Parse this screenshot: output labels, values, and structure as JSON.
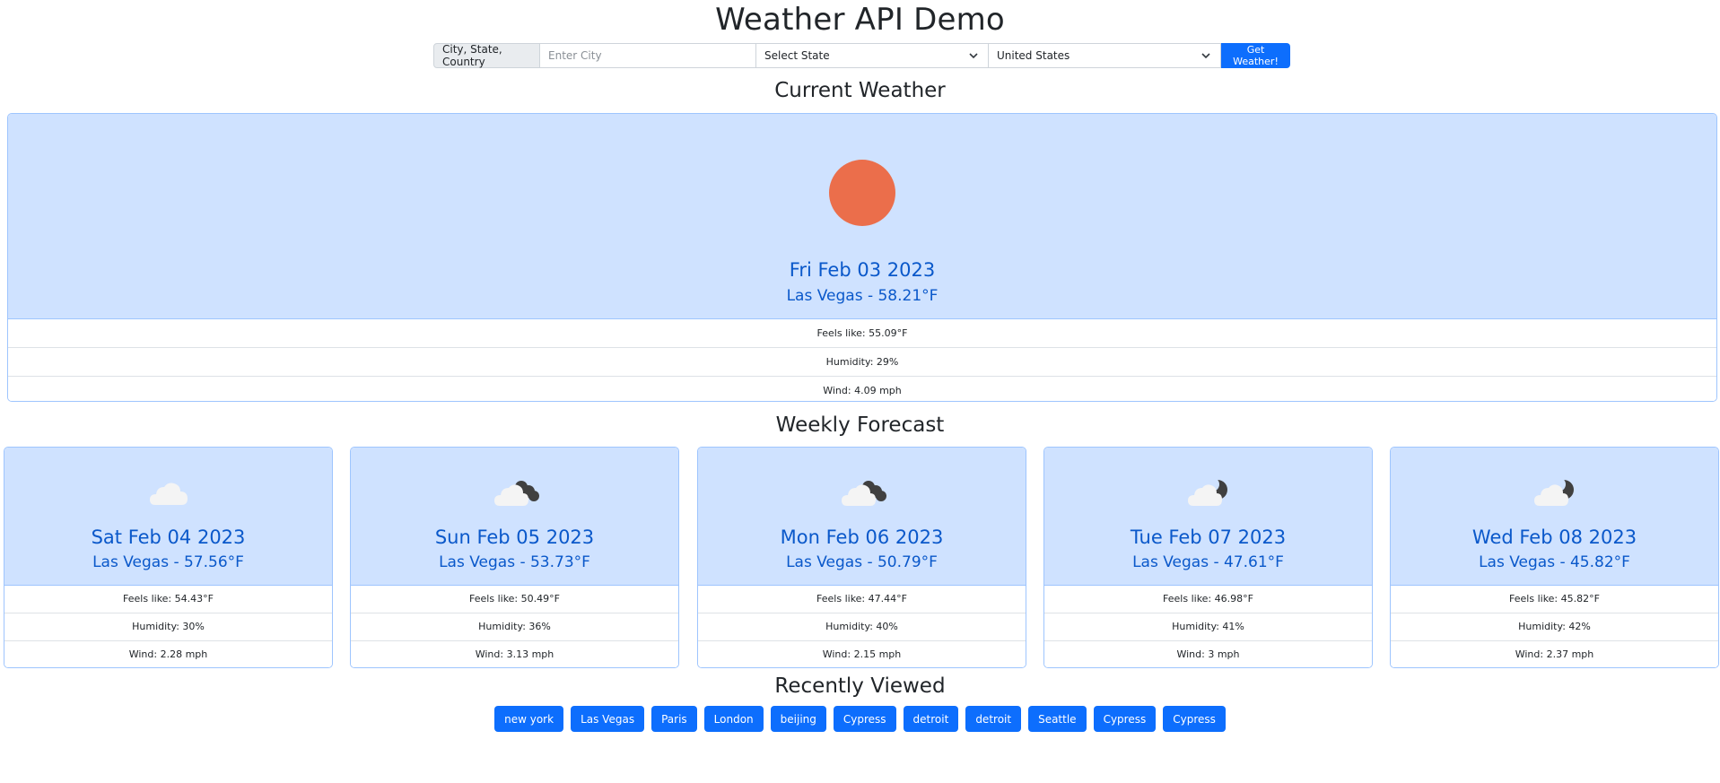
{
  "app": {
    "title": "Weather API Demo"
  },
  "search": {
    "addon_label": "City, State, Country",
    "city_placeholder": "Enter City",
    "city_value": "",
    "state_selected": "Select State",
    "country_selected": "United States",
    "submit_label": "Get Weather!"
  },
  "current": {
    "heading": "Current Weather",
    "icon": "sun-icon",
    "date": "Fri Feb 03 2023",
    "location_temp": "Las Vegas - 58.21°F",
    "feels_like": "Feels like: 55.09°F",
    "humidity": "Humidity: 29%",
    "wind": "Wind: 4.09 mph"
  },
  "forecast": {
    "heading": "Weekly Forecast",
    "days": [
      {
        "icon": "cloud-icon",
        "date": "Sat Feb 04 2023",
        "location_temp": "Las Vegas - 57.56°F",
        "feels_like": "Feels like: 54.43°F",
        "humidity": "Humidity: 30%",
        "wind": "Wind: 2.28 mph"
      },
      {
        "icon": "cloudy-night-icon",
        "date": "Sun Feb 05 2023",
        "location_temp": "Las Vegas - 53.73°F",
        "feels_like": "Feels like: 50.49°F",
        "humidity": "Humidity: 36%",
        "wind": "Wind: 3.13 mph"
      },
      {
        "icon": "cloudy-night-icon",
        "date": "Mon Feb 06 2023",
        "location_temp": "Las Vegas - 50.79°F",
        "feels_like": "Feels like: 47.44°F",
        "humidity": "Humidity: 40%",
        "wind": "Wind: 2.15 mph"
      },
      {
        "icon": "partly-cloudy-night-icon",
        "date": "Tue Feb 07 2023",
        "location_temp": "Las Vegas - 47.61°F",
        "feels_like": "Feels like: 46.98°F",
        "humidity": "Humidity: 41%",
        "wind": "Wind: 3 mph"
      },
      {
        "icon": "partly-cloudy-night-icon",
        "date": "Wed Feb 08 2023",
        "location_temp": "Las Vegas - 45.82°F",
        "feels_like": "Feels like: 45.82°F",
        "humidity": "Humidity: 42%",
        "wind": "Wind: 2.37 mph"
      }
    ]
  },
  "recent": {
    "heading": "Recently Viewed",
    "items": [
      "new york",
      "Las Vegas",
      "Paris",
      "London",
      "beijing",
      "Cypress",
      "detroit",
      "detroit",
      "Seattle",
      "Cypress",
      "Cypress"
    ]
  },
  "colors": {
    "primary": "#0d6efd",
    "card_bg": "#cfe2ff",
    "card_border": "#9ec5fe",
    "title_blue": "#0a58ca",
    "sun": "#eb6e4b"
  }
}
